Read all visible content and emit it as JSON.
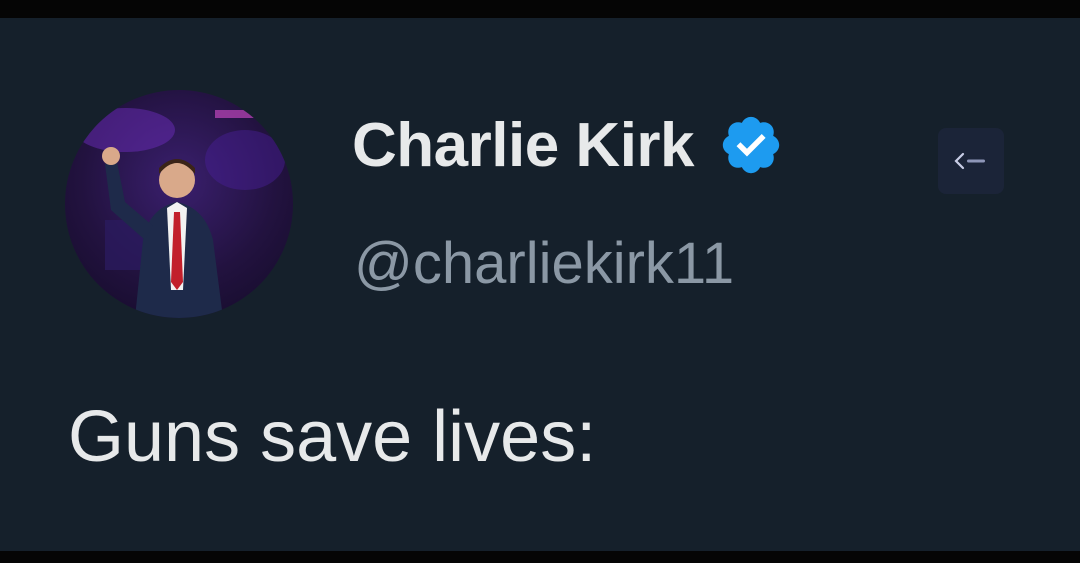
{
  "tweet": {
    "author": {
      "display_name": "Charlie Kirk",
      "handle": "@charliekirk11",
      "verified": true,
      "verified_badge_icon": "verified-badge-icon",
      "affiliate_icon": "organization-affiliation-icon",
      "avatar_icon": "profile-photo"
    },
    "text": "Guns save lives:"
  },
  "colors": {
    "background": "#15202b",
    "primary_text": "#e7e9ea",
    "secondary_text": "#8b98a5",
    "verified_blue": "#1d9bf0"
  }
}
